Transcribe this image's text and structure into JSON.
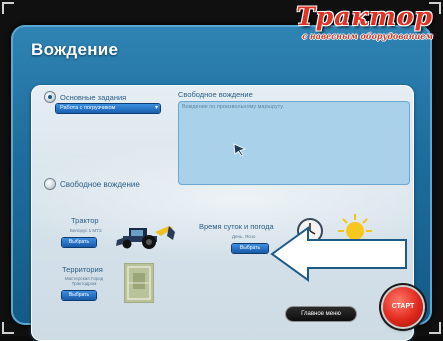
{
  "brand": {
    "title": "Трактор",
    "subtitle": "с навесным оборудованием"
  },
  "window": {
    "title": "Вождение"
  },
  "modes": {
    "basic_label": "Основные задания",
    "basic_selected": "Работа с погрузчиком",
    "free_header": "Свободное вождение",
    "free_description": "Вождение по произвольному маршруту.",
    "free_label": "Свободное вождение"
  },
  "tractor": {
    "label": "Трактор",
    "model": "Белорус 1 МТЗ",
    "button": "Выбрать"
  },
  "territory": {
    "label": "Территория",
    "info": "Мастерская Город Трактодром",
    "button": "Выбрать"
  },
  "time_weather": {
    "label": "Время суток и погода",
    "info": "День, Ясно",
    "button": "Выбрать"
  },
  "footer": {
    "main_menu": "Главное меню",
    "start": "СТАРТ"
  },
  "colors": {
    "window_blue": "#1f6e9e",
    "accent_red": "#e23225",
    "button_blue": "#185aa8"
  }
}
